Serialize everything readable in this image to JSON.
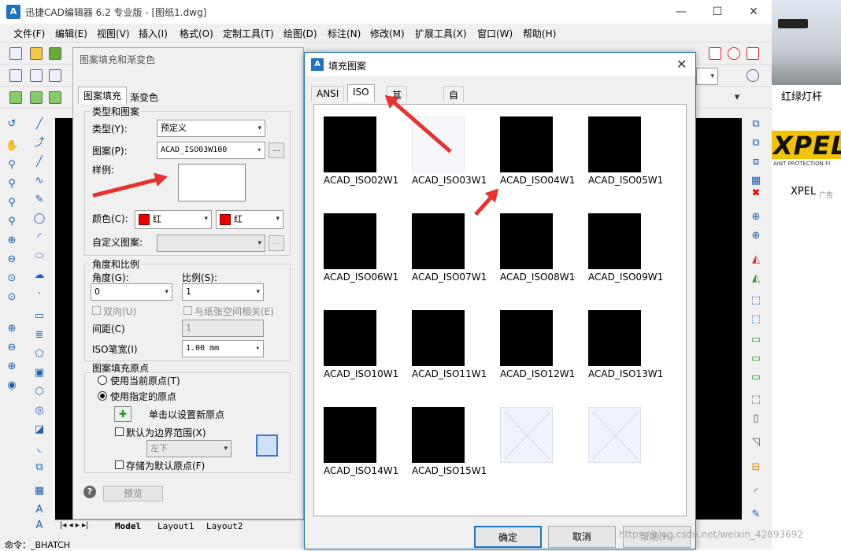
{
  "app": {
    "title": "迅捷CAD编辑器 6.2 专业版 - [图纸1.dwg]",
    "icon": "cad-app-icon",
    "window_controls": [
      "—",
      "☐",
      "✕"
    ]
  },
  "menu": [
    "文件(F)",
    "编辑(E)",
    "视图(V)",
    "插入(I)",
    "格式(O)",
    "定制工具(T)",
    "绘图(D)",
    "标注(N)",
    "修改(M)",
    "扩展工具(X)",
    "窗口(W)",
    "帮助(H)"
  ],
  "layout_tabs": [
    "Model",
    "Layout1",
    "Layout2"
  ],
  "command_line": "命令：_BHATCH",
  "hatch_dialog": {
    "title": "图案填充和渐变色",
    "tabs": [
      "图案填充",
      "渐变色"
    ],
    "type_group": "类型和图案",
    "type_label": "类型(Y):",
    "type_value": "预定义",
    "pattern_label": "图案(P):",
    "pattern_value": "ACAD_ISO03W100",
    "swatch_label": "样例:",
    "color_label": "颜色(C):",
    "color_value": "红",
    "color_value2": "红",
    "custom_label": "自定义图案:",
    "ellipsis": "...",
    "angle_group": "角度和比例",
    "angle_label": "角度(G):",
    "angle_value": "0",
    "scale_label": "比例(S):",
    "scale_value": "1",
    "bidir_label": "双向(U)",
    "paper_label": "与纸张空间相关(E)",
    "spacing_label": "间距(C)",
    "spacing_value": "1",
    "iso_label": "ISO笔宽(I)",
    "iso_value": "1.00 mm",
    "origin_group": "图案填充原点",
    "use_current": "使用当前原点(T)",
    "use_specified": "使用指定的原点",
    "click_set": "单击以设置新原点",
    "default_boundary": "默认为边界范围(X)",
    "position_value": "左下",
    "store_default": "存储为默认原点(F)",
    "help_icon": "?",
    "preview": "预览"
  },
  "fill_dialog": {
    "title": "填充图案",
    "close": "✕",
    "tabs": [
      "ANSI",
      "ISO",
      "其他预定义",
      "自定义"
    ],
    "selected_tab": "ISO",
    "patterns": [
      {
        "name": "ACAD_ISO02W1",
        "style": "solid"
      },
      {
        "name": "ACAD_ISO03W1",
        "style": "empty"
      },
      {
        "name": "ACAD_ISO04W1",
        "style": "solid"
      },
      {
        "name": "ACAD_ISO05W1",
        "style": "solid"
      },
      {
        "name": "ACAD_ISO06W1",
        "style": "solid"
      },
      {
        "name": "ACAD_ISO07W1",
        "style": "solid"
      },
      {
        "name": "ACAD_ISO08W1",
        "style": "solid"
      },
      {
        "name": "ACAD_ISO09W1",
        "style": "solid"
      },
      {
        "name": "ACAD_ISO10W1",
        "style": "solid"
      },
      {
        "name": "ACAD_ISO11W1",
        "style": "solid"
      },
      {
        "name": "ACAD_ISO12W1",
        "style": "solid"
      },
      {
        "name": "ACAD_ISO13W1",
        "style": "solid"
      },
      {
        "name": "ACAD_ISO14W1",
        "style": "solid"
      },
      {
        "name": "ACAD_ISO15W1",
        "style": "solid"
      },
      {
        "name": "",
        "style": "light"
      },
      {
        "name": "",
        "style": "light"
      }
    ],
    "ok": "确定",
    "cancel": "取消",
    "help": "帮助(H)"
  },
  "side_ads": {
    "caption1": "红绿灯杆",
    "brand": "XPEL",
    "brand_tagline": "AINT PROTECTION FI",
    "caption2": "XPEL",
    "ad_badge": "广告"
  },
  "watermark": "https://blog.csdn.net/weixin_42893692",
  "accent_color": "#1e73be",
  "swatch_color": "#e00000"
}
